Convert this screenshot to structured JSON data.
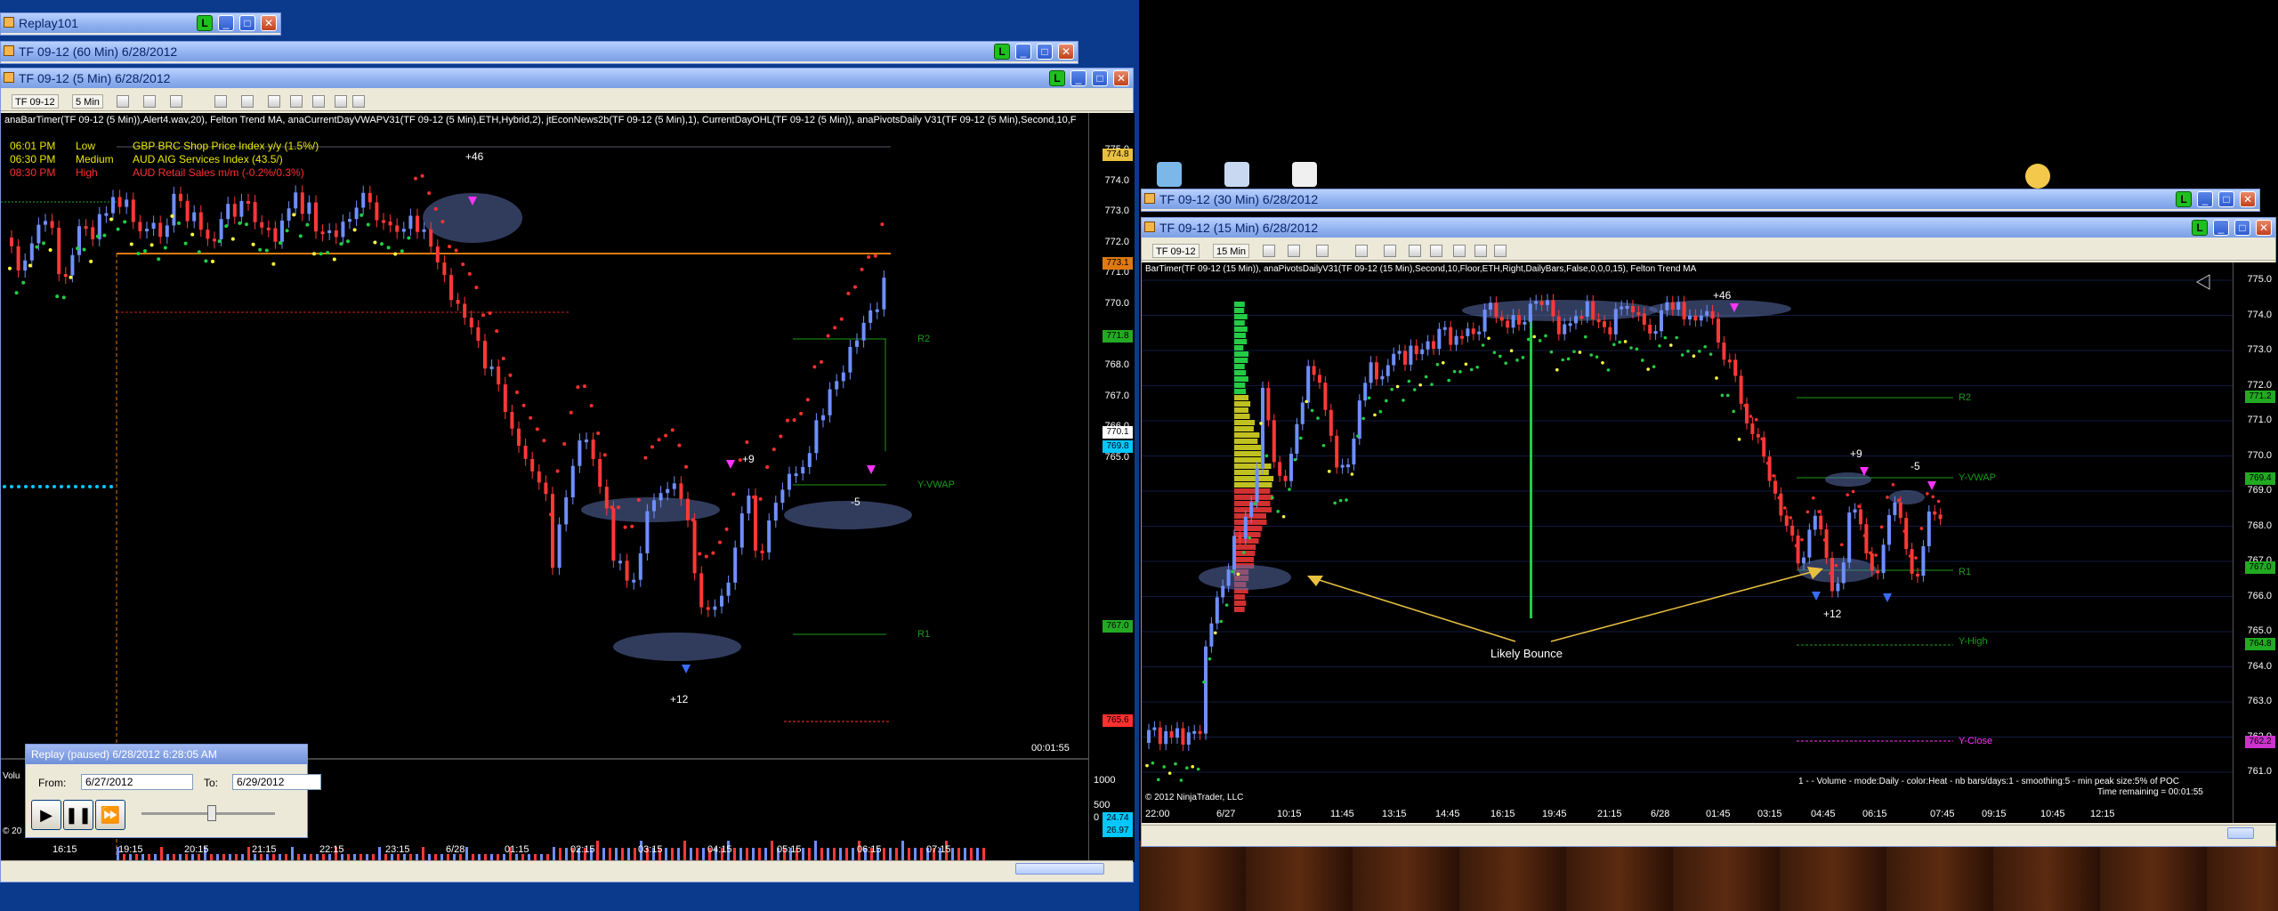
{
  "replay_main": {
    "title": "Replay101"
  },
  "win60": {
    "title": "TF 09-12 (60 Min)  6/28/2012"
  },
  "win5": {
    "title": "TF 09-12 (5 Min)  6/28/2012",
    "toolbar": {
      "instrument": "TF 09-12",
      "interval": "5 Min"
    },
    "indicators": "anaBarTimer(TF 09-12 (5 Min)),Alert4.wav,20), Felton Trend MA, anaCurrentDayVWAPV31(TF 09-12 (5 Min),ETH,Hybrid,2), jtEconNews2b(TF 09-12 (5 Min),1), CurrentDayOHL(TF 09-12 (5 Min)), anaPivotsDaily V31(TF 09-12 (5 Min),Second,10,F",
    "news": [
      {
        "time": "06:01 PM",
        "impact": "Low",
        "text": "GBP  BRC Shop Price Index y/y (1.5%/)"
      },
      {
        "time": "06:30 PM",
        "impact": "Medium",
        "text": "AUD  AIG Services Index (43.5/)"
      },
      {
        "time": "08:30 PM",
        "impact": "High",
        "text": "AUD  Retail Sales m/m (-0.2%/0.3%)"
      }
    ],
    "price_ticks": [
      "775.0",
      "774.0",
      "773.0",
      "772.0",
      "771.0",
      "770.0",
      "769.0",
      "768.0",
      "767.0",
      "766.0",
      "765.0"
    ],
    "tags": [
      {
        "text": "774.8",
        "color": "#e8c040"
      },
      {
        "text": "773.1",
        "color": "#e07a10"
      },
      {
        "text": "771.8",
        "color": "#22aa22"
      },
      {
        "text": "770.1",
        "color": "#ffffff"
      },
      {
        "text": "769.8",
        "color": "#00c8ff"
      },
      {
        "text": "767.0",
        "color": "#22aa22"
      },
      {
        "text": "765.6",
        "color": "#ff3030"
      }
    ],
    "labels": {
      "plus46": "+46",
      "plus9": "+9",
      "minus5": "-5",
      "plus12": "+12",
      "r2": "R2",
      "yvwap": "Y-VWAP",
      "r1": "R1",
      "timer": "00:01:55"
    },
    "volume_ticks": [
      "1000",
      "500",
      "0"
    ],
    "volume_tags": [
      "24.74",
      "26.97"
    ],
    "vol_label": "Volu",
    "copyright": "© 20",
    "time_ticks": [
      "16:15",
      "19:15",
      "20:15",
      "21:15",
      "22:15",
      "23:15",
      "6/28",
      "01:15",
      "02:15",
      "03:15",
      "04:15",
      "05:15",
      "06:15",
      "07:15"
    ]
  },
  "replay_panel": {
    "title": "Replay (paused) 6/28/2012 6:28:05 AM",
    "from_label": "From:",
    "from_value": "6/27/2012",
    "to_label": "To:",
    "to_value": "6/29/2012"
  },
  "win30": {
    "title": "TF 09-12 (30 Min)  6/28/2012"
  },
  "win15": {
    "title": "TF 09-12 (15 Min)  6/28/2012",
    "toolbar": {
      "instrument": "TF 09-12",
      "interval": "15 Min"
    },
    "indicators": "BarTimer(TF 09-12 (15 Min)), anaPivotsDailyV31(TF 09-12 (15 Min),Second,10,Floor,ETH,Right,DailyBars,False,0,0,0,15), Felton Trend MA",
    "price_ticks": [
      "775.0",
      "774.0",
      "773.0",
      "772.0",
      "771.0",
      "770.0",
      "769.0",
      "768.0",
      "767.0",
      "766.0",
      "765.0",
      "764.0",
      "763.0",
      "762.0",
      "761.0"
    ],
    "tags": [
      {
        "text": "771.2",
        "color": "#22aa22"
      },
      {
        "text": "769.4",
        "color": "#22aa22"
      },
      {
        "text": "767.0",
        "color": "#22aa22"
      },
      {
        "text": "764.8",
        "color": "#22aa22"
      },
      {
        "text": "762.2",
        "color": "#cc33cc"
      }
    ],
    "labels": {
      "plus46": "+46",
      "plus9": "+9",
      "minus5": "-5",
      "plus12": "+12",
      "r2": "R2",
      "yvwap": "Y-VWAP",
      "r1": "R1",
      "yhigh": "Y-High",
      "yclose": "Y-Close",
      "bounce": "Likely Bounce",
      "copyright": "© 2012 NinjaTrader, LLC"
    },
    "volume_note": "1 -  - Volume - mode:Daily - color:Heat - nb bars/days:1 - smoothing:5 - min peak size:5% of POC",
    "time_remaining": "Time remaining = 00:01:55",
    "time_ticks": [
      "22:00",
      "6/27",
      "10:15",
      "11:45",
      "13:15",
      "14:45",
      "16:15",
      "19:45",
      "21:15",
      "6/28",
      "01:45",
      "03:15",
      "04:45",
      "06:15",
      "07:45",
      "09:15",
      "10:45",
      "12:15"
    ]
  },
  "colors": {
    "up": "#6e8fff",
    "down": "#ff3838",
    "trend_up": "#22cc44",
    "trend_down": "#ff3030",
    "pivot_green": "#1a9c1a",
    "yclose": "#ff33ff"
  }
}
